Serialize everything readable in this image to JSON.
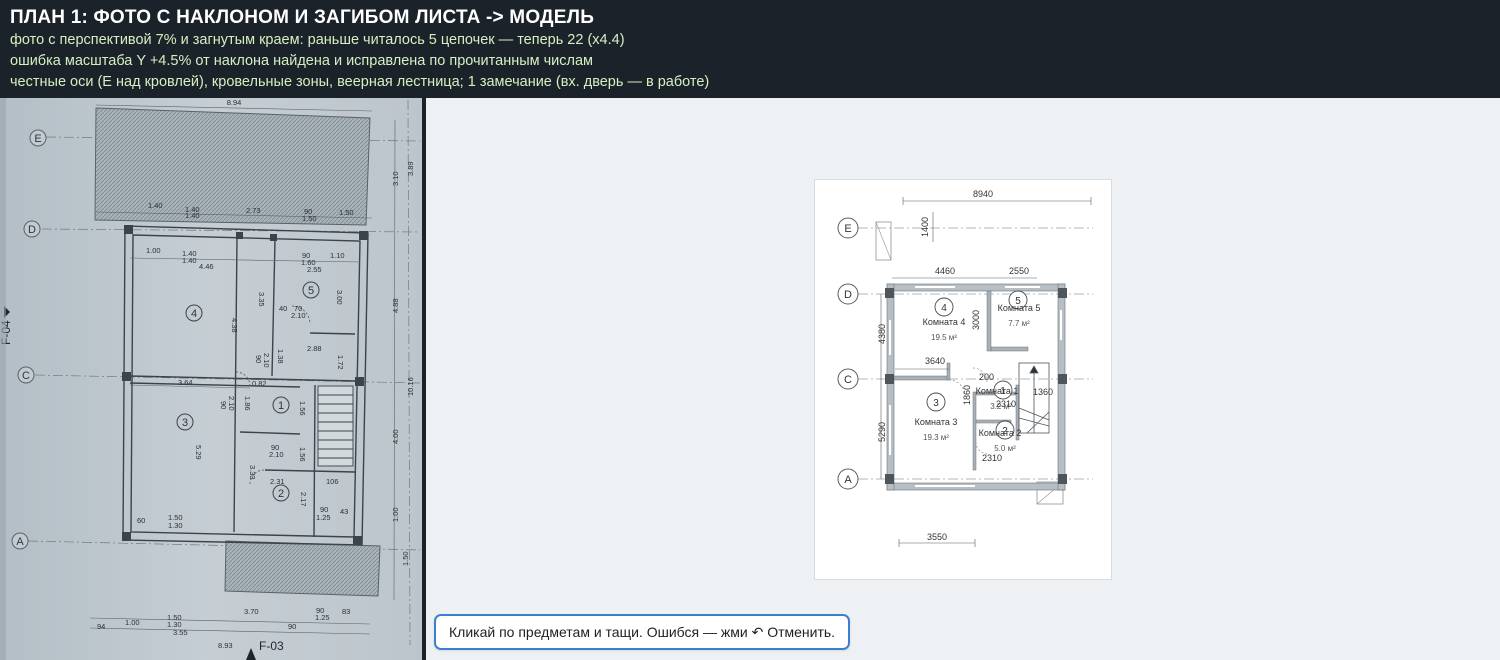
{
  "header": {
    "title": "ПЛАН 1: ФОТО С НАКЛОНОМ И ЗАГИБОМ ЛИСТА -> МОДЕЛЬ",
    "line1": "фото с перспективой 7% и загнутым краем: раньше читалось 5 цепочек — теперь 22 (x4.4)",
    "line2": "ошибка масштаба Y +4.5% от наклона найдена и исправлена по прочитанным числам",
    "line3": "честные оси (E над кровлей), кровельные зоны, веерная лестница; 1 замечание (вх. дверь — в работе)"
  },
  "photo": {
    "axes": [
      "E",
      "D",
      "C",
      "A"
    ],
    "rooms": [
      "4",
      "5",
      "3",
      "1",
      "2"
    ],
    "dims": {
      "top_total": "8.94",
      "top_row": [
        "1.40",
        "1.40",
        "1.40",
        "2.73",
        "90",
        "1.50",
        "1.50"
      ],
      "row_d": [
        "1.00",
        "1.40",
        "1.40",
        "4.46",
        "90",
        "1.60",
        "1.10",
        "2.55"
      ],
      "inner": [
        "4.38",
        "3.35",
        "3.00",
        "40",
        "70",
        "2.10",
        "2.88",
        "90",
        "2.10",
        "1.38",
        "1.72"
      ],
      "row_c": [
        "3.64",
        "0.82"
      ],
      "lower": [
        "90",
        "2.10",
        "1.86",
        "1.56",
        "5.29",
        "90",
        "2.10",
        "1.56",
        "3.33",
        "2.31",
        "106",
        "2.17",
        "90",
        "1.25",
        "43"
      ],
      "bottom_row": [
        "60",
        "1.50",
        "1.30"
      ],
      "right": [
        "3.10",
        "3.89",
        "4.88",
        "10.16",
        "4.00",
        "1.00",
        "1.50"
      ],
      "bottom_chain": [
        "94",
        "1.00",
        "1.50",
        "1.30",
        "3.55",
        "3.70",
        "90",
        "1.25",
        "83"
      ],
      "bottom_total": "8.93",
      "section_left": "F-04",
      "section_bottom": "F-03"
    }
  },
  "model": {
    "axes": [
      "E",
      "D",
      "C",
      "A"
    ],
    "dims": {
      "top": "8940",
      "roof_depth": "1400",
      "d_left": "4460",
      "d_right": "2550",
      "left_d_c": "4380",
      "left_c_a": "5290",
      "room4_vert": "3000",
      "c_left": "3640",
      "v1860": "1860",
      "d1360": "1360",
      "d2310a": "2310",
      "d2310b": "2310",
      "d200": "200",
      "bottom": "3550"
    },
    "rooms": [
      {
        "num": "4",
        "name": "Комната 4",
        "area": "19.5 м²"
      },
      {
        "num": "5",
        "name": "Комната 5",
        "area": "7.7 м²"
      },
      {
        "num": "3",
        "name": "Комната 3",
        "area": "19.3 м²"
      },
      {
        "num": "1",
        "name": "Комната 1",
        "area": "3.2 м²"
      },
      {
        "num": "2",
        "name": "Комната 2",
        "area": "5.0 м²"
      }
    ]
  },
  "toast": {
    "text": "Кликай по предметам и тащи. Ошибся — жми ↶ Отменить."
  }
}
